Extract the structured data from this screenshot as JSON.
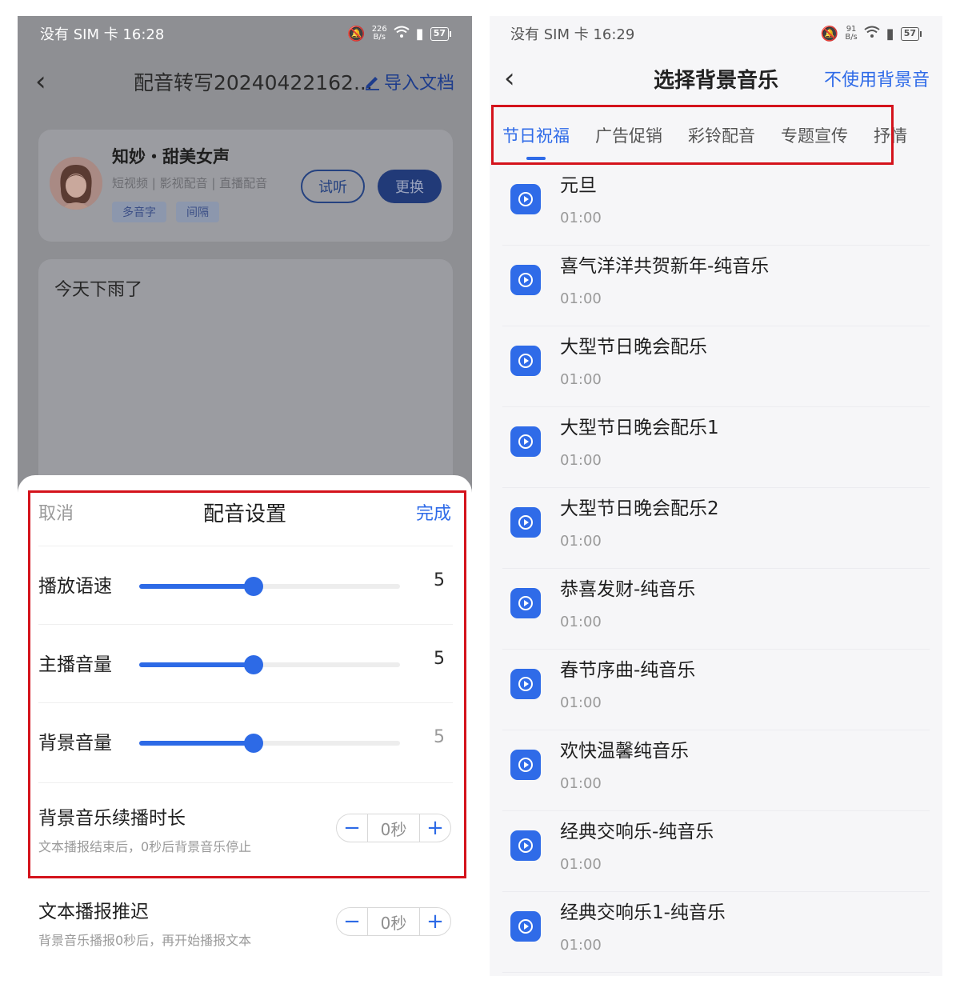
{
  "left": {
    "status": {
      "carrier_time": "没有 SIM 卡 16:28",
      "speed_top": "226",
      "speed_unit": "B/s",
      "battery": "57"
    },
    "nav": {
      "title": "配音转写20240422162...",
      "import_label": "导入文档"
    },
    "voice": {
      "name": "知妙・甜美女声",
      "tags": "短视频 | 影视配音 | 直播配音",
      "chips": [
        "多音字",
        "间隔"
      ],
      "try_label": "试听",
      "change_label": "更换"
    },
    "text_content": "今天下雨了",
    "sheet": {
      "cancel": "取消",
      "title": "配音设置",
      "done": "完成",
      "sliders": [
        {
          "label": "播放语速",
          "value": "5",
          "fraction": 0.44
        },
        {
          "label": "主播音量",
          "value": "5",
          "fraction": 0.44
        },
        {
          "label": "背景音量",
          "value": "5",
          "fraction": 0.44
        }
      ],
      "steppers": [
        {
          "label": "背景音乐续播时长",
          "sub": "文本播报结束后，0秒后背景音乐停止",
          "value": "0秒"
        },
        {
          "label": "文本播报推迟",
          "sub": "背景音乐播报0秒后，再开始播报文本",
          "value": "0秒"
        }
      ]
    }
  },
  "right": {
    "status": {
      "carrier_time": "没有 SIM 卡 16:29",
      "speed_top": "91",
      "speed_unit": "B/s",
      "battery": "57"
    },
    "nav": {
      "title": "选择背景音乐",
      "no_music": "不使用背景音"
    },
    "tabs": [
      "节日祝福",
      "广告促销",
      "彩铃配音",
      "专题宣传",
      "抒情"
    ],
    "songs": [
      {
        "name": "元旦",
        "duration": "01:00"
      },
      {
        "name": "喜气洋洋共贺新年-纯音乐",
        "duration": "01:00"
      },
      {
        "name": "大型节日晚会配乐",
        "duration": "01:00"
      },
      {
        "name": "大型节日晚会配乐1",
        "duration": "01:00"
      },
      {
        "name": "大型节日晚会配乐2",
        "duration": "01:00"
      },
      {
        "name": "恭喜发财-纯音乐",
        "duration": "01:00"
      },
      {
        "name": "春节序曲-纯音乐",
        "duration": "01:00"
      },
      {
        "name": "欢快温馨纯音乐",
        "duration": "01:00"
      },
      {
        "name": "经典交响乐-纯音乐",
        "duration": "01:00"
      },
      {
        "name": "经典交响乐1-纯音乐",
        "duration": "01:00"
      }
    ]
  },
  "colors": {
    "accent": "#2f6be8",
    "highlight": "#d4131c"
  }
}
